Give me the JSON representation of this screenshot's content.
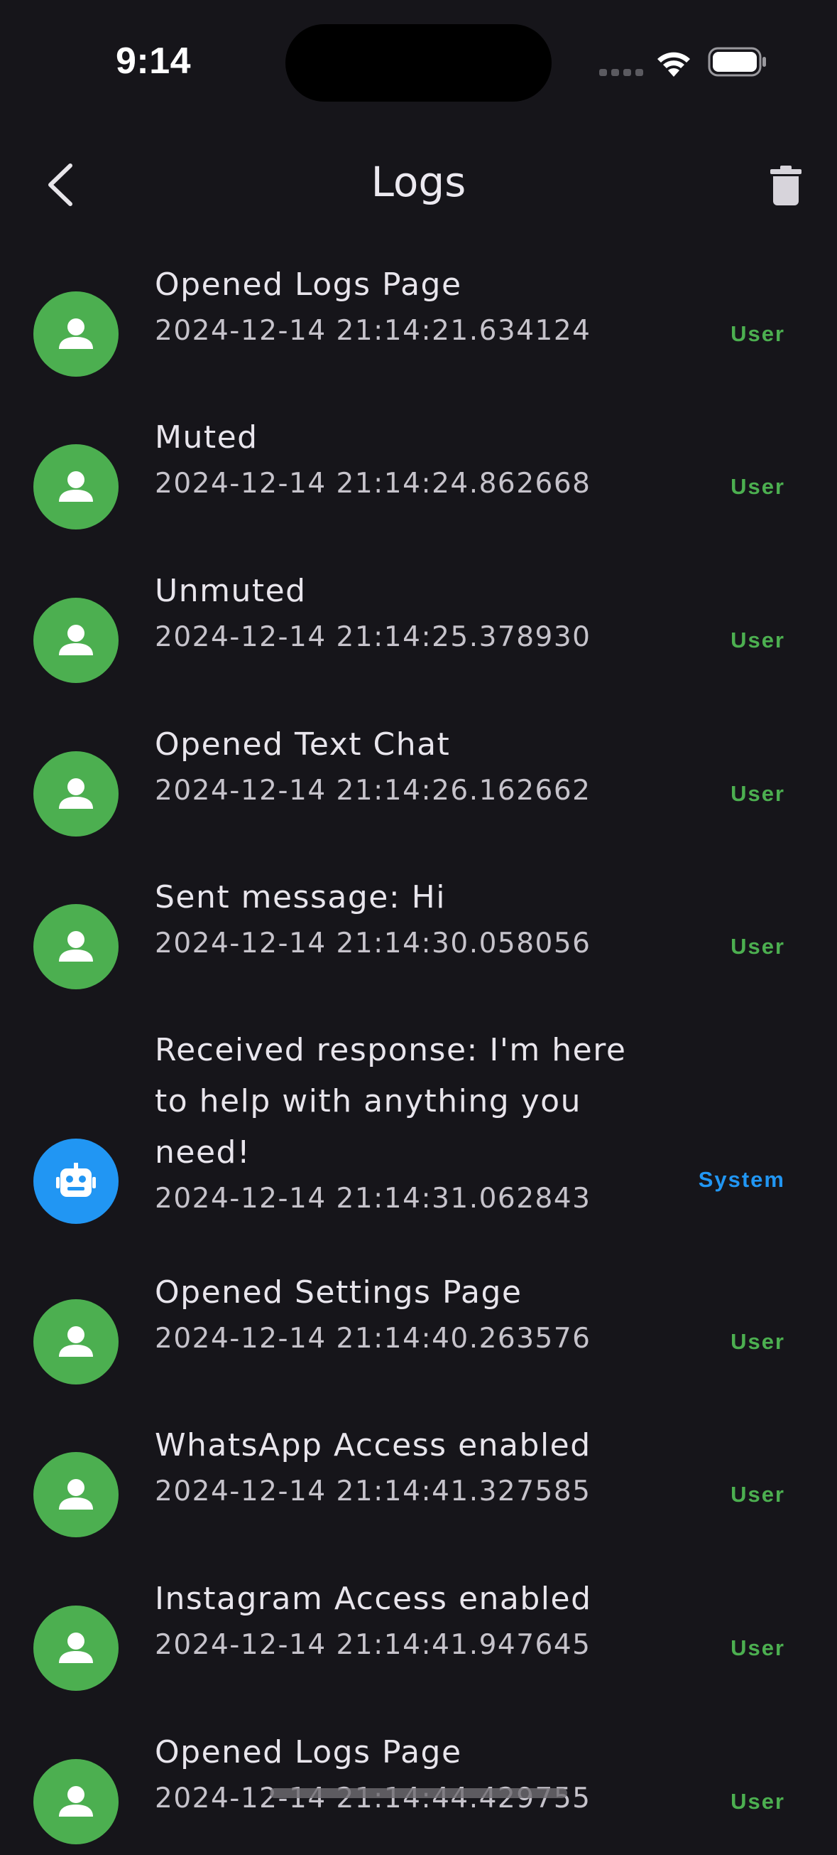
{
  "status_bar": {
    "time": "9:14",
    "signal_icon": "cellular-signal-icon",
    "wifi_icon": "wifi-icon",
    "battery_icon": "battery-icon"
  },
  "app_bar": {
    "title": "Logs",
    "back_icon": "chevron-left-icon",
    "delete_icon": "trash-icon"
  },
  "colors": {
    "background": "#16151a",
    "user": "#4caf50",
    "system": "#2196f3"
  },
  "logs": [
    {
      "title": "Opened Logs Page",
      "time": "2024-12-14 21:14:21.634124",
      "source": "User",
      "type": "user"
    },
    {
      "title": "Muted",
      "time": "2024-12-14 21:14:24.862668",
      "source": "User",
      "type": "user"
    },
    {
      "title": "Unmuted",
      "time": "2024-12-14 21:14:25.378930",
      "source": "User",
      "type": "user"
    },
    {
      "title": "Opened Text Chat",
      "time": "2024-12-14 21:14:26.162662",
      "source": "User",
      "type": "user"
    },
    {
      "title": "Sent message: Hi",
      "time": "2024-12-14 21:14:30.058056",
      "source": "User",
      "type": "user"
    },
    {
      "title": "Received response: I'm here to help with anything you need!",
      "time": "2024-12-14 21:14:31.062843",
      "source": "System",
      "type": "system"
    },
    {
      "title": "Opened Settings Page",
      "time": "2024-12-14 21:14:40.263576",
      "source": "User",
      "type": "user"
    },
    {
      "title": "WhatsApp Access enabled",
      "time": "2024-12-14 21:14:41.327585",
      "source": "User",
      "type": "user"
    },
    {
      "title": "Instagram Access enabled",
      "time": "2024-12-14 21:14:41.947645",
      "source": "User",
      "type": "user"
    },
    {
      "title": "Opened Logs Page",
      "time": "2024-12-14 21:14:44.429755",
      "source": "User",
      "type": "user"
    }
  ]
}
